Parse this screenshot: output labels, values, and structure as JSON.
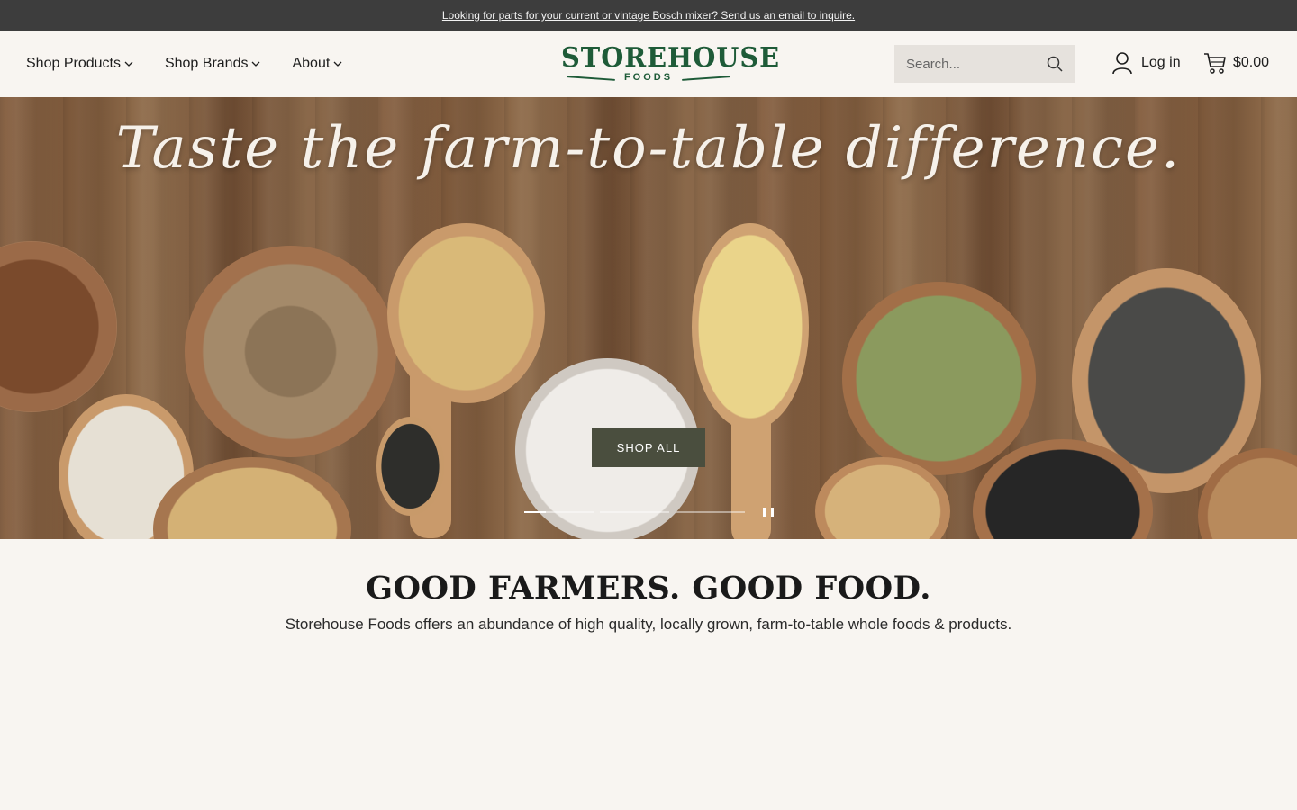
{
  "announcement": {
    "text": "Looking for parts for your current or vintage Bosch mixer? Send us an email to inquire."
  },
  "nav": {
    "items": [
      {
        "label": "Shop Products"
      },
      {
        "label": "Shop Brands"
      },
      {
        "label": "About"
      }
    ]
  },
  "logo": {
    "main": "STOREHOUSE",
    "sub": "FOODS"
  },
  "search": {
    "placeholder": "Search..."
  },
  "account": {
    "login_label": "Log in"
  },
  "cart": {
    "total": "$0.00"
  },
  "hero": {
    "title": "Taste the farm-to-table difference.",
    "cta_label": "SHOP ALL",
    "slide_count": 3,
    "active_slide": 1
  },
  "intro": {
    "title": "GOOD FARMERS. GOOD FOOD.",
    "text": "Storehouse Foods offers an abundance of high quality, locally grown, farm-to-table whole foods & products."
  },
  "colors": {
    "brand_green": "#1e5b38",
    "announcement_bg": "#3d3d3d",
    "page_bg": "#f8f5f1",
    "cta_bg": "#4a4e3e"
  }
}
